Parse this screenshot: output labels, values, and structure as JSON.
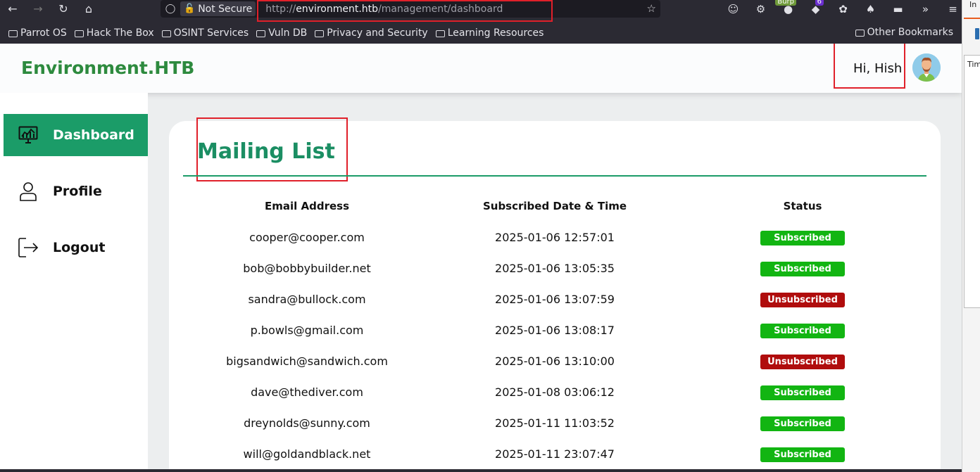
{
  "browser": {
    "not_secure": "Not Secure",
    "url_scheme": "http://",
    "url_host": "environment.htb",
    "url_path": "/management/dashboard",
    "ext_badge_count": "6",
    "ext_burp": "Burp",
    "bookmarks": [
      "Parrot OS",
      "Hack The Box",
      "OSINT Services",
      "Vuln DB",
      "Privacy and Security",
      "Learning Resources"
    ],
    "other_bookmarks": "Other Bookmarks",
    "side_strip_top": "In",
    "side_strip_panel": "Tim"
  },
  "app": {
    "brand": "Environment.HTB",
    "greeting": "Hi, Hish",
    "nav": [
      {
        "label": "Dashboard",
        "icon": "dashboard-icon"
      },
      {
        "label": "Profile",
        "icon": "user-icon"
      },
      {
        "label": "Logout",
        "icon": "logout-icon"
      }
    ]
  },
  "mailing_list": {
    "title": "Mailing List",
    "headers": [
      "Email Address",
      "Subscribed Date & Time",
      "Status"
    ],
    "rows": [
      {
        "email": "cooper@cooper.com",
        "date": "2025-01-06 12:57:01",
        "status": "Subscribed"
      },
      {
        "email": "bob@bobbybuilder.net",
        "date": "2025-01-06 13:05:35",
        "status": "Subscribed"
      },
      {
        "email": "sandra@bullock.com",
        "date": "2025-01-06 13:07:59",
        "status": "Unsubscribed"
      },
      {
        "email": "p.bowls@gmail.com",
        "date": "2025-01-06 13:08:17",
        "status": "Subscribed"
      },
      {
        "email": "bigsandwich@sandwich.com",
        "date": "2025-01-06 13:10:00",
        "status": "Unsubscribed"
      },
      {
        "email": "dave@thediver.com",
        "date": "2025-01-08 03:06:12",
        "status": "Subscribed"
      },
      {
        "email": "dreynolds@sunny.com",
        "date": "2025-01-11 11:03:52",
        "status": "Subscribed"
      },
      {
        "email": "will@goldandblack.net",
        "date": "2025-01-11 23:07:47",
        "status": "Subscribed"
      }
    ]
  },
  "colors": {
    "subscribed": "#12b512",
    "unsubscribed": "#b00d0d",
    "accent": "#1b9c68",
    "brand": "#2d8a3e"
  }
}
